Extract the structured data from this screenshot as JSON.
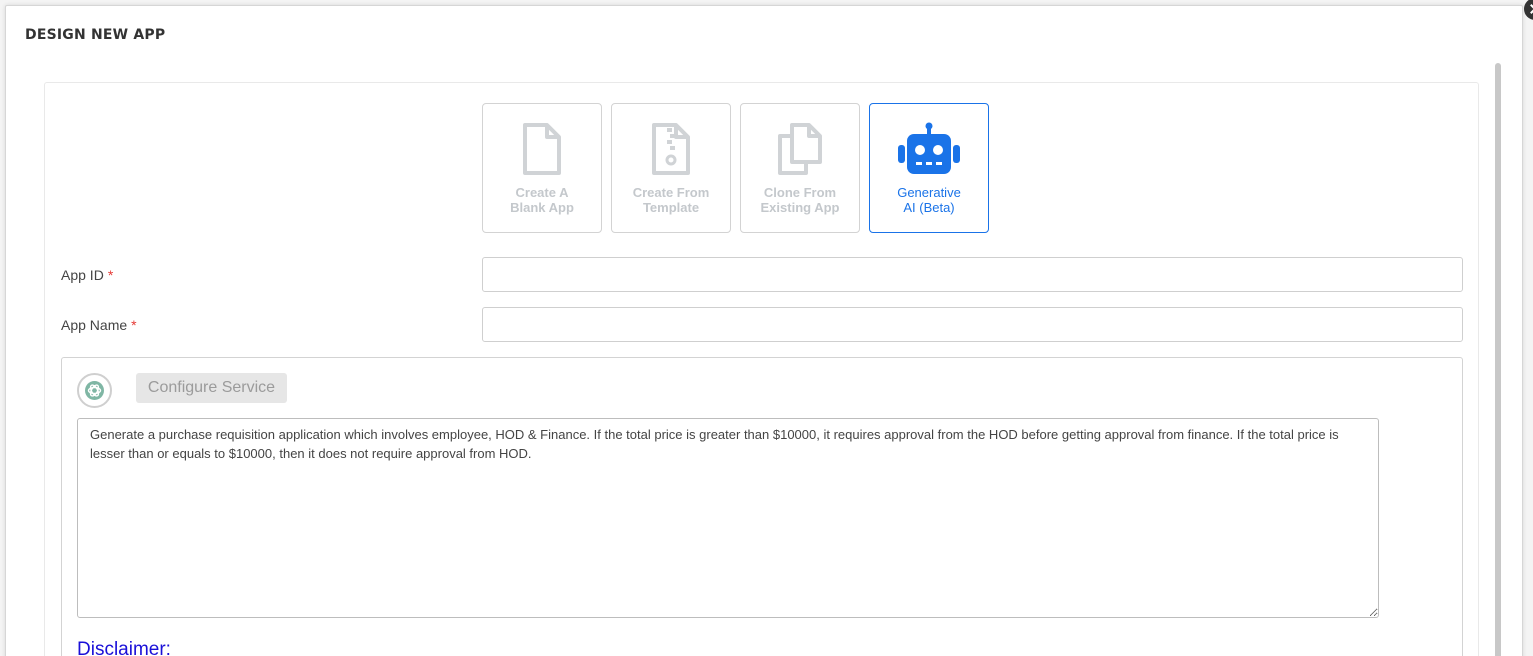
{
  "dialog": {
    "title": "DESIGN NEW APP"
  },
  "options": [
    {
      "label": "Create A\nBlank App",
      "icon": "file-icon",
      "active": false
    },
    {
      "label": "Create From\nTemplate",
      "icon": "zip-file-icon",
      "active": false
    },
    {
      "label": "Clone From\nExisting App",
      "icon": "copy-icon",
      "active": false
    },
    {
      "label": "Generative\nAI (Beta)",
      "icon": "robot-icon",
      "active": true
    }
  ],
  "form": {
    "app_id": {
      "label": "App ID",
      "required_mark": "*",
      "value": ""
    },
    "app_name": {
      "label": "App Name",
      "required_mark": "*",
      "value": ""
    }
  },
  "ai": {
    "logo_icon": "openai-logo-icon",
    "configure_label": "Configure Service",
    "prompt": "Generate a purchase requisition application which involves employee, HOD & Finance. If the total price is greater than $10000, it requires approval from the HOD before getting approval from finance. If the total price is lesser than or equals to $10000, then it does not require approval from HOD.",
    "disclaimer_heading": "Disclaimer:"
  },
  "colors": {
    "accent": "#1a73e8",
    "disabled_icon": "#d0d3d6",
    "disclaimer": "#1a10d8",
    "required": "#e53935"
  }
}
